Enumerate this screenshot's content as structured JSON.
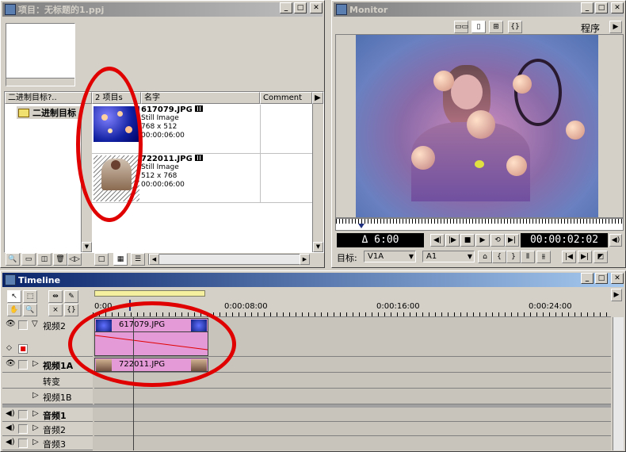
{
  "project": {
    "title": "项目：无标题的1.ppj",
    "columns": {
      "bin": "二进制目标?..",
      "count": "2 项目s",
      "name": "名字",
      "comment": "Comment"
    },
    "bin_item": "二进制目标",
    "items": [
      {
        "name": "617079.JPG",
        "type": "Still Image",
        "dims": "768 x 512",
        "duration": "00:00:06:00"
      },
      {
        "name": "722011.JPG",
        "type": "Still Image",
        "dims": "512 x 768",
        "duration": "00:00:06:00"
      }
    ]
  },
  "monitor": {
    "title": "Monitor",
    "program_label": "程序",
    "delta_time": "Δ 6:00",
    "timecode": "00:00:02:02",
    "target_label": "目标:",
    "video_target": "V1A",
    "audio_target": "A1"
  },
  "timeline": {
    "title": "Timeline",
    "ruler": [
      "0:00",
      "0:00:08:00",
      "0:00:16:00",
      "0:00:24:00"
    ],
    "tracks": {
      "v2": "视频2",
      "v1a": "视频1A",
      "transition": "转变",
      "v1b": "视频1B",
      "a1": "音频1",
      "a2": "音频2",
      "a3": "音频3"
    },
    "clips": {
      "v2": "617079.JPG",
      "v1a": "722011.JPG"
    }
  },
  "colors": {
    "title_active": "#0a246a",
    "clip": "#e49ad6",
    "annotation": "#e00000",
    "timeline_bar": "#f5f0a0"
  }
}
